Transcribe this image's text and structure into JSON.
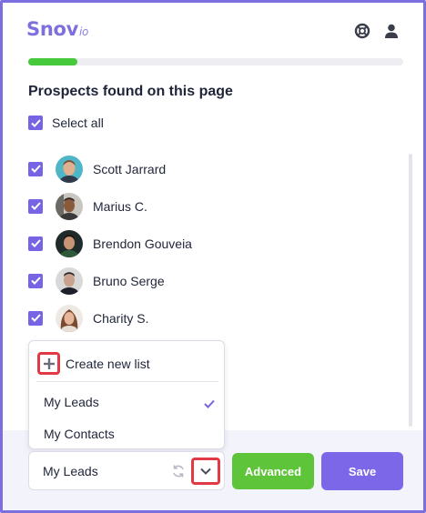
{
  "app": {
    "logo_main": "Snov",
    "logo_suffix": "io",
    "accent_color": "#7b67e8",
    "success_color": "#46c93a"
  },
  "header_icons": [
    "lifebuoy-icon",
    "user-icon"
  ],
  "progress": {
    "fraction": 0.13
  },
  "title": "Prospects found on this page",
  "select_all": {
    "label": "Select all",
    "checked": true
  },
  "prospects": [
    {
      "name": "Scott Jarrard",
      "checked": true
    },
    {
      "name": "Marius C.",
      "checked": true
    },
    {
      "name": "Brendon Gouveia",
      "checked": true
    },
    {
      "name": "Bruno Serge",
      "checked": true
    },
    {
      "name": "Charity S.",
      "checked": true
    }
  ],
  "list_dropdown": {
    "create_label": "Create new list",
    "options": [
      {
        "label": "My Leads",
        "selected": true
      },
      {
        "label": "My Contacts",
        "selected": false
      }
    ]
  },
  "list_select": {
    "value": "My Leads"
  },
  "buttons": {
    "advanced": "Advanced",
    "save": "Save"
  }
}
